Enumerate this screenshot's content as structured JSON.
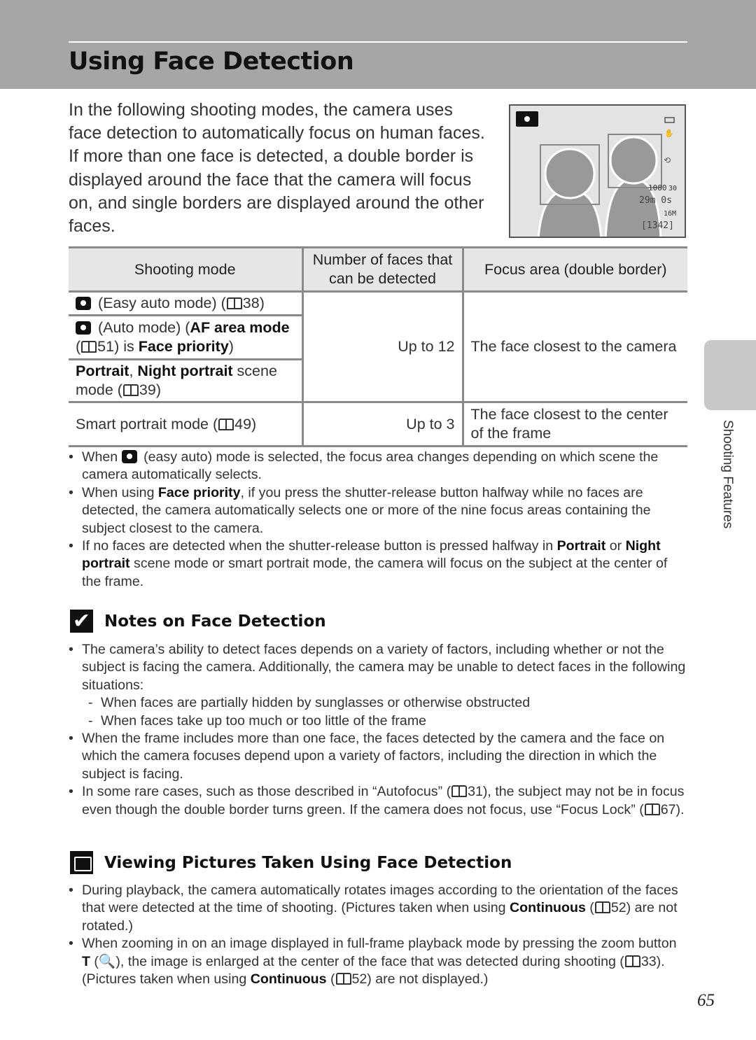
{
  "header": {
    "title": "Using Face Detection"
  },
  "intro": "In the following shooting modes, the camera uses face detection to automatically focus on human faces. If more than one face is detected, a double border is displayed around the face that the camera will focus on, and single borders are displayed around the other faces.",
  "screen": {
    "video": "1080",
    "fps": "30",
    "time": "29m 0s",
    "size": "16M",
    "count": "[1342]"
  },
  "table": {
    "headers": [
      "Shooting mode",
      "Number of faces that can be detected",
      "Focus area (double border)"
    ],
    "row1": [
      {
        "icon": "easy-auto"
      },
      {
        "t": " (Easy auto mode) ("
      },
      {
        "icon": "ref"
      },
      {
        "t": "38)"
      }
    ],
    "row2": [
      {
        "icon": "auto"
      },
      {
        "t": " (Auto mode) ("
      },
      {
        "t": "AF area mode",
        "b": 1
      },
      {
        "t": " ("
      },
      {
        "icon": "ref"
      },
      {
        "t": "51) is "
      },
      {
        "t": "Face priority",
        "b": 1
      },
      {
        "t": ")"
      }
    ],
    "row3": [
      {
        "t": "Portrait",
        "b": 1
      },
      {
        "t": ", "
      },
      {
        "t": "Night portrait",
        "b": 1
      },
      {
        "t": " scene mode ("
      },
      {
        "icon": "ref"
      },
      {
        "t": "39)"
      }
    ],
    "faces1": "Up to 12",
    "focus1": "The face closest to the camera",
    "row4": [
      {
        "t": "Smart portrait mode ("
      },
      {
        "icon": "ref"
      },
      {
        "t": "49)"
      }
    ],
    "faces2": "Up to 3",
    "focus2": "The face closest to the center of the frame"
  },
  "bullets1": [
    [
      {
        "t": "When "
      },
      {
        "icon": "easy-auto"
      },
      {
        "t": " (easy auto) mode is selected, the focus area changes depending on which scene the camera automatically selects."
      }
    ],
    [
      {
        "t": "When using "
      },
      {
        "t": "Face priority",
        "b": 1
      },
      {
        "t": ", if you press the shutter-release button halfway while no faces are detected, the camera automatically selects one or more of the nine focus areas containing the subject closest to the camera."
      }
    ],
    [
      {
        "t": "If no faces are detected when the shutter-release button is pressed halfway in "
      },
      {
        "t": "Portrait",
        "b": 1
      },
      {
        "t": " or "
      },
      {
        "t": "Night portrait",
        "b": 1
      },
      {
        "t": " scene mode or smart portrait mode, the camera will focus on the subject at the center of the frame."
      }
    ]
  ],
  "notes": {
    "title": "Notes on Face Detection",
    "items": [
      [
        {
          "t": "The camera’s ability to detect faces depends on a variety of factors, including whether or not the subject is facing the camera. Additionally, the camera may be unable to detect faces in the following situations:"
        }
      ],
      [
        {
          "t": "When faces are partially hidden by sunglasses or otherwise obstructed"
        }
      ],
      [
        {
          "t": "When faces take up too much or too little of the frame"
        }
      ],
      [
        {
          "t": "When the frame includes more than one face, the faces detected by the camera and the face on which the camera focuses depend upon a variety of factors, including the direction in which the subject is facing."
        }
      ],
      [
        {
          "t": "In some rare cases, such as those described in “Autofocus” ("
        },
        {
          "icon": "ref"
        },
        {
          "t": "31), the subject may not be in focus even though the double border turns green. If the camera does not focus, use “Focus Lock” ("
        },
        {
          "icon": "ref"
        },
        {
          "t": "67)."
        }
      ]
    ]
  },
  "viewing": {
    "title": "Viewing Pictures Taken Using Face Detection",
    "items": [
      [
        {
          "t": "During playback, the camera automatically rotates images according to the orientation of the faces that were detected at the time of shooting. (Pictures taken when using "
        },
        {
          "t": "Continuous",
          "b": 1
        },
        {
          "t": " ("
        },
        {
          "icon": "ref"
        },
        {
          "t": "52) are not rotated.)"
        }
      ],
      [
        {
          "t": "When zooming in on an image displayed in full-frame playback mode by pressing the zoom button "
        },
        {
          "t": "T",
          "b": 1
        },
        {
          "t": " (🔍), the image is enlarged at the center of the face that was detected during shooting ("
        },
        {
          "icon": "ref"
        },
        {
          "t": "33). (Pictures taken when using "
        },
        {
          "t": "Continuous",
          "b": 1
        },
        {
          "t": " ("
        },
        {
          "icon": "ref"
        },
        {
          "t": "52) are not displayed.)"
        }
      ]
    ]
  },
  "side_tab": "Shooting Features",
  "page_number": "65"
}
